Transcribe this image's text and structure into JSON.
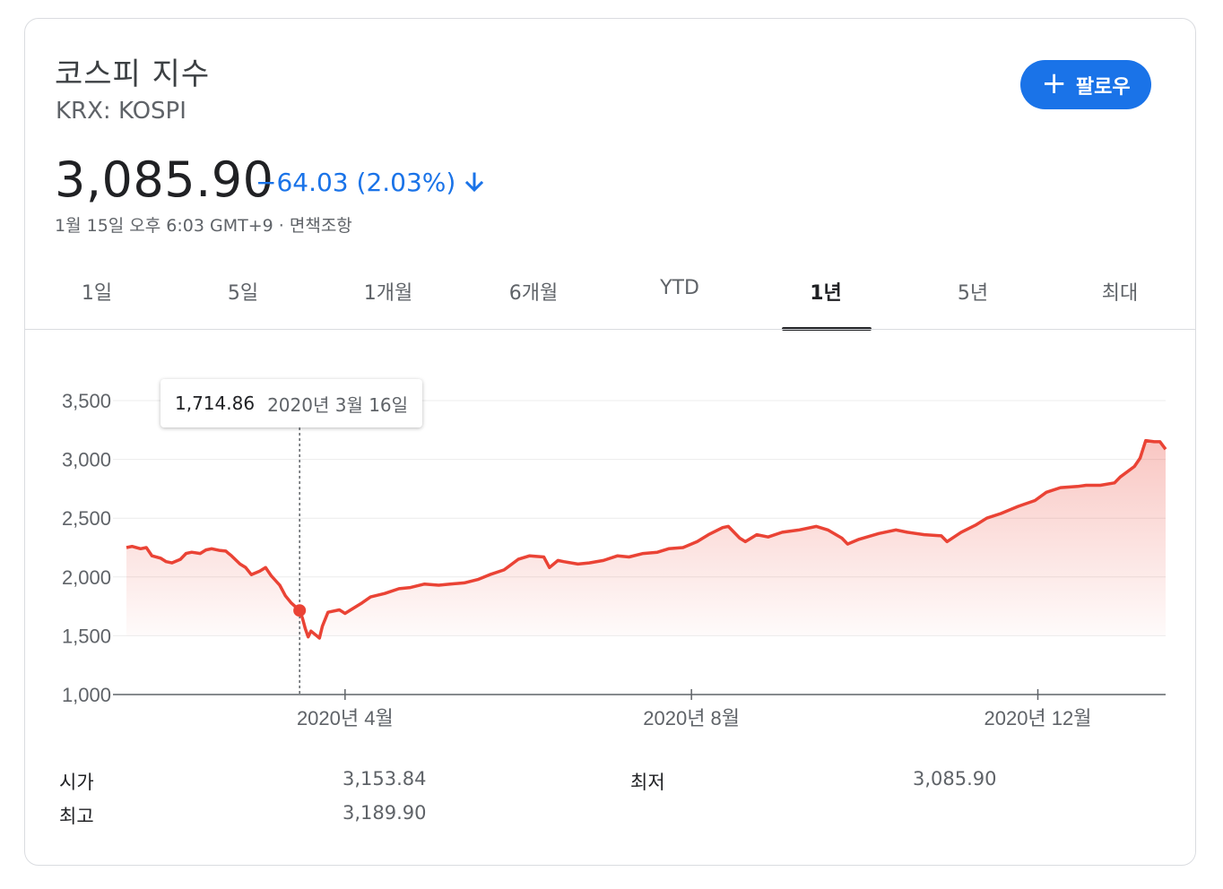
{
  "header": {
    "title": "코스피 지수",
    "ticker": "KRX: KOSPI",
    "follow_label": "팔로우",
    "follow_icon": "plus-icon"
  },
  "quote": {
    "price": "3,085.90",
    "change": "−64.03 (2.03%)",
    "direction_icon": "arrow-down-icon",
    "timestamp": "1월 15일 오후 6:03 GMT+9 · 면책조항"
  },
  "tabs": [
    {
      "label": "1일"
    },
    {
      "label": "5일"
    },
    {
      "label": "1개월"
    },
    {
      "label": "6개월"
    },
    {
      "label": "YTD"
    },
    {
      "label": "1년",
      "active": true
    },
    {
      "label": "5년"
    },
    {
      "label": "최대"
    }
  ],
  "tooltip": {
    "value": "1,714.86",
    "date": "2020년 3월 16일"
  },
  "colors": {
    "accent": "#1a73e8",
    "line": "#ea4335",
    "text": "#202124",
    "muted": "#5f6368"
  },
  "chart_data": {
    "type": "area",
    "yticks": [
      "3,500",
      "3,000",
      "2,500",
      "2,000",
      "1,500",
      "1,000"
    ],
    "ylim": [
      1000,
      3500
    ],
    "xticks": [
      {
        "label": "2020년 4월",
        "x": "2020-04-01"
      },
      {
        "label": "2020년 8월",
        "x": "2020-08-01"
      },
      {
        "label": "2020년 12월",
        "x": "2020-12-01"
      }
    ],
    "xlim": [
      "2020-01-15",
      "2021-01-15"
    ],
    "grid": true,
    "highlight": {
      "x": "2020-03-16",
      "y": 1714.86
    },
    "series": [
      {
        "x": [
          "2020-01-15",
          "2020-01-17",
          "2020-01-20",
          "2020-01-22",
          "2020-01-24",
          "2020-01-27",
          "2020-01-29",
          "2020-01-31",
          "2020-02-03",
          "2020-02-05",
          "2020-02-07",
          "2020-02-10",
          "2020-02-12",
          "2020-02-14",
          "2020-02-17",
          "2020-02-19",
          "2020-02-21",
          "2020-02-24",
          "2020-02-26",
          "2020-02-28",
          "2020-03-02",
          "2020-03-04",
          "2020-03-06",
          "2020-03-09",
          "2020-03-11",
          "2020-03-13",
          "2020-03-16",
          "2020-03-17",
          "2020-03-18",
          "2020-03-19",
          "2020-03-20",
          "2020-03-23",
          "2020-03-24",
          "2020-03-26",
          "2020-03-30",
          "2020-04-01",
          "2020-04-03",
          "2020-04-07",
          "2020-04-10",
          "2020-04-15",
          "2020-04-20",
          "2020-04-24",
          "2020-04-29",
          "2020-05-04",
          "2020-05-08",
          "2020-05-13",
          "2020-05-18",
          "2020-05-22",
          "2020-05-27",
          "2020-06-01",
          "2020-06-05",
          "2020-06-10",
          "2020-06-12",
          "2020-06-15",
          "2020-06-17",
          "2020-06-22",
          "2020-06-26",
          "2020-07-01",
          "2020-07-06",
          "2020-07-10",
          "2020-07-15",
          "2020-07-20",
          "2020-07-24",
          "2020-07-29",
          "2020-08-03",
          "2020-08-07",
          "2020-08-12",
          "2020-08-14",
          "2020-08-18",
          "2020-08-20",
          "2020-08-24",
          "2020-08-28",
          "2020-09-02",
          "2020-09-08",
          "2020-09-14",
          "2020-09-18",
          "2020-09-23",
          "2020-09-25",
          "2020-09-29",
          "2020-10-06",
          "2020-10-12",
          "2020-10-16",
          "2020-10-22",
          "2020-10-28",
          "2020-10-30",
          "2020-11-04",
          "2020-11-09",
          "2020-11-13",
          "2020-11-18",
          "2020-11-24",
          "2020-11-30",
          "2020-12-04",
          "2020-12-09",
          "2020-12-15",
          "2020-12-18",
          "2020-12-23",
          "2020-12-28",
          "2020-12-30",
          "2021-01-04",
          "2021-01-06",
          "2021-01-08",
          "2021-01-11",
          "2021-01-13",
          "2021-01-15"
        ],
        "values": [
          2250,
          2260,
          2240,
          2250,
          2180,
          2160,
          2130,
          2120,
          2150,
          2200,
          2210,
          2200,
          2230,
          2240,
          2225,
          2220,
          2180,
          2110,
          2080,
          2020,
          2050,
          2080,
          2010,
          1930,
          1840,
          1780,
          1714.86,
          1650,
          1560,
          1490,
          1540,
          1480,
          1580,
          1700,
          1720,
          1690,
          1720,
          1780,
          1830,
          1860,
          1900,
          1910,
          1940,
          1930,
          1940,
          1950,
          1980,
          2020,
          2060,
          2150,
          2180,
          2170,
          2080,
          2140,
          2130,
          2110,
          2120,
          2140,
          2180,
          2170,
          2200,
          2210,
          2240,
          2250,
          2300,
          2360,
          2420,
          2430,
          2330,
          2300,
          2360,
          2340,
          2380,
          2400,
          2430,
          2400,
          2330,
          2280,
          2320,
          2370,
          2400,
          2380,
          2360,
          2350,
          2300,
          2380,
          2440,
          2500,
          2540,
          2600,
          2650,
          2720,
          2760,
          2770,
          2780,
          2780,
          2800,
          2850,
          2940,
          3010,
          3160,
          3150,
          3150,
          3085.9
        ]
      }
    ]
  },
  "stats": {
    "open_label": "시가",
    "open_value": "3,153.84",
    "high_label": "최고",
    "high_value": "3,189.90",
    "low_label": "최저",
    "low_value": "3,085.90"
  }
}
